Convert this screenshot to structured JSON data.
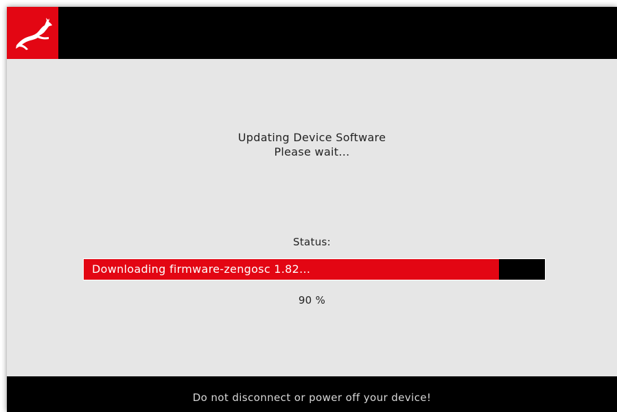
{
  "header": {
    "logo_icon": "gazelle-logo-icon",
    "brand_color": "#e30613"
  },
  "main": {
    "title": "Updating Device Software",
    "subtitle": "Please wait...",
    "status_label": "Status:",
    "progress": {
      "text": "Downloading firmware-zengosc 1.82...",
      "percent_text": "90 %",
      "fill_percent": 90,
      "fill_color": "#e30613",
      "track_color": "#000000"
    }
  },
  "footer": {
    "warning": "Do not disconnect or power off your device!"
  }
}
